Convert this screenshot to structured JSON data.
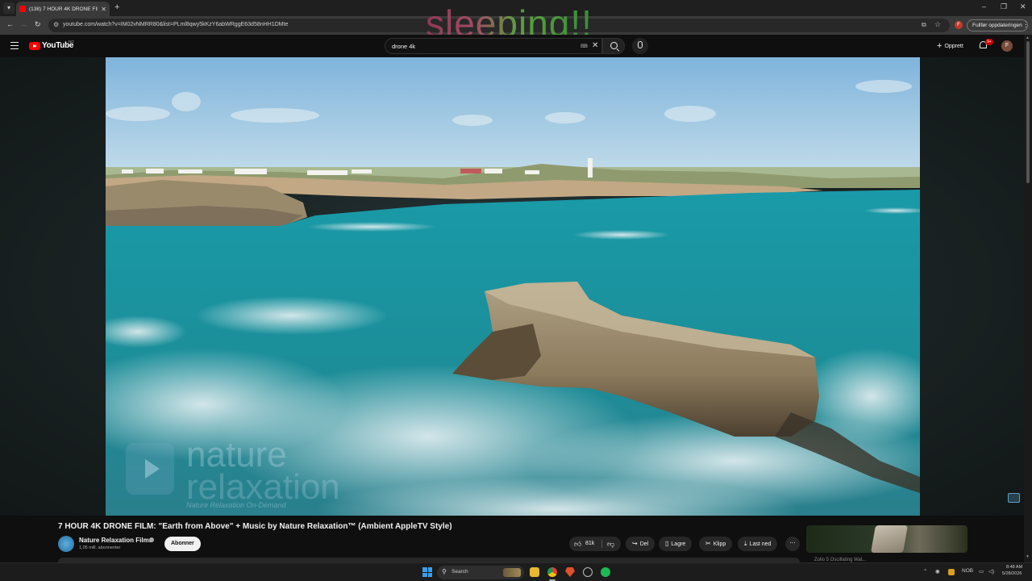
{
  "browser": {
    "tab": {
      "title": "(138) 7 HOUR 4K DRONE FILM"
    },
    "url": "youtube.com/watch?v=IM02vNMRR80&list=PLml8qwy5kKzY6abWRggE63d58nHH1DMte",
    "update_button": "Fullfør oppdateringen",
    "extension_letter": "F"
  },
  "overlay": {
    "text": "sleeping!!"
  },
  "youtube": {
    "logo_text": "YouTube",
    "country_code": "NO",
    "search": {
      "query": "drone 4k"
    },
    "create_label": "Opprett",
    "notifications_badge": "9+",
    "avatar_letter": "F"
  },
  "video": {
    "watermark_line1": "nature",
    "watermark_line2": "relaxation",
    "watermark_tagline": "Nature Relaxation On-Demand"
  },
  "details": {
    "title": "7 HOUR 4K DRONE FILM: \"Earth from Above\" + Music by Nature Relaxation™ (Ambient AppleTV Style)",
    "channel_name": "Nature Relaxation Films",
    "subscribers": "1,05 mill. abonnenter",
    "subscribe_label": "Abonner",
    "likes": "81k",
    "share_label": "Del",
    "save_label": "Lagre",
    "clip_label": "Klipp",
    "download_label": "Last ned",
    "recommendation_subtitle": "Zolio 5 Oscillating Wat..."
  },
  "taskbar": {
    "search_label": "Search",
    "language": "NOB",
    "time": "8:48 AM",
    "date": "5/28/2026"
  },
  "colors": {
    "youtube_red": "#ff0000",
    "page_background": "#0f0f0f",
    "overlay_gradient": [
      "#9b3a5a",
      "#5fae3f"
    ]
  }
}
